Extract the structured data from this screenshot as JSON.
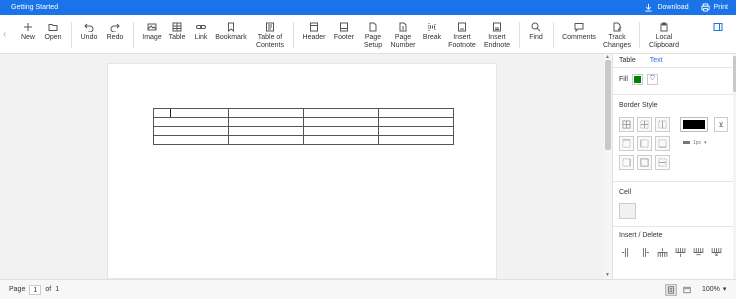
{
  "app": {
    "title": "Getting Started",
    "download_label": "Download",
    "print_label": "Print",
    "accent_color": "#1a73e8"
  },
  "toolbar": {
    "items": [
      {
        "key": "new",
        "label": "New",
        "icon": "plus-icon"
      },
      {
        "key": "open",
        "label": "Open",
        "icon": "folder-icon"
      },
      {
        "key": "undo",
        "label": "Undo",
        "icon": "undo-icon"
      },
      {
        "key": "redo",
        "label": "Redo",
        "icon": "redo-icon"
      },
      {
        "key": "image",
        "label": "Image",
        "icon": "image-icon"
      },
      {
        "key": "table",
        "label": "Table",
        "icon": "table-icon"
      },
      {
        "key": "link",
        "label": "Link",
        "icon": "link-icon"
      },
      {
        "key": "bookmark",
        "label": "Bookmark",
        "icon": "bookmark-icon"
      },
      {
        "key": "toc",
        "label_line1": "Table of",
        "label_line2": "Contents",
        "icon": "toc-icon"
      },
      {
        "key": "header",
        "label": "Header",
        "icon": "header-icon"
      },
      {
        "key": "footer",
        "label": "Footer",
        "icon": "footer-icon"
      },
      {
        "key": "page_setup",
        "label_line1": "Page",
        "label_line2": "Setup",
        "icon": "page-setup-icon"
      },
      {
        "key": "page_number",
        "label_line1": "Page",
        "label_line2": "Number",
        "icon": "page-number-icon"
      },
      {
        "key": "break",
        "label": "Break",
        "icon": "break-icon"
      },
      {
        "key": "insert_footnote",
        "label_line1": "Insert",
        "label_line2": "Footnote",
        "icon": "footnote-icon"
      },
      {
        "key": "insert_endnote",
        "label_line1": "Insert",
        "label_line2": "Endnote",
        "icon": "endnote-icon"
      },
      {
        "key": "find",
        "label": "Find",
        "icon": "search-icon"
      },
      {
        "key": "comments",
        "label": "Comments",
        "icon": "comment-icon"
      },
      {
        "key": "track_changes",
        "label_line1": "Track",
        "label_line2": "Changes",
        "icon": "track-changes-icon"
      },
      {
        "key": "local_clipboard",
        "label_line1": "Local",
        "label_line2": "Clipboard",
        "icon": "clipboard-icon"
      }
    ]
  },
  "panel": {
    "tabs": [
      {
        "label": "Table",
        "active": false
      },
      {
        "label": "Text",
        "active": true
      }
    ],
    "fill_label": "Fill",
    "fill_color": "#008000",
    "border_style_title": "Border Style",
    "border_color": "#000000",
    "border_width": "1px",
    "cell_title": "Cell",
    "insert_delete_title": "Insert / Delete"
  },
  "statusbar": {
    "page_label": "Page",
    "page_current": "1",
    "page_of_label": "of",
    "page_total": "1",
    "zoom": "100%"
  }
}
